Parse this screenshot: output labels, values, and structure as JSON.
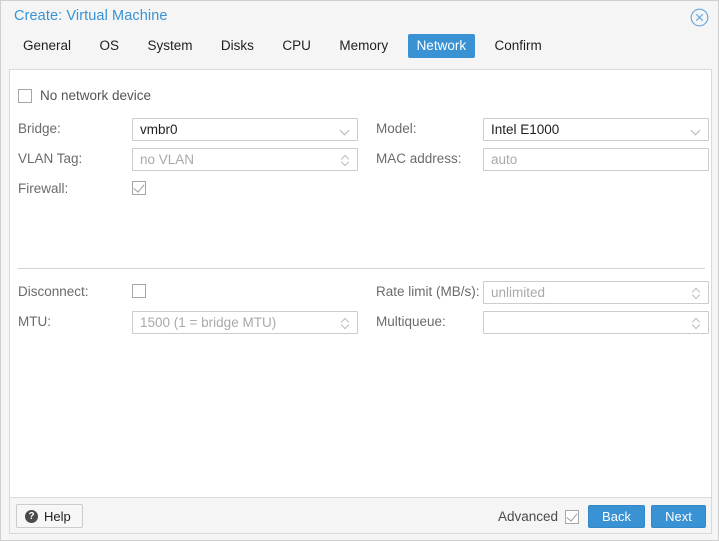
{
  "header": {
    "title": "Create: Virtual Machine",
    "close_icon": "close-circle-icon"
  },
  "tabs": [
    {
      "label": "General",
      "active": false
    },
    {
      "label": "OS",
      "active": false
    },
    {
      "label": "System",
      "active": false
    },
    {
      "label": "Disks",
      "active": false
    },
    {
      "label": "CPU",
      "active": false
    },
    {
      "label": "Memory",
      "active": false
    },
    {
      "label": "Network",
      "active": true
    },
    {
      "label": "Confirm",
      "active": false
    }
  ],
  "form": {
    "no_network_device": {
      "label": "No network device",
      "checked": false
    },
    "bridge": {
      "label": "Bridge:",
      "value": "vmbr0",
      "is_placeholder": false,
      "control": "combobox"
    },
    "vlan_tag": {
      "label": "VLAN Tag:",
      "value": "no VLAN",
      "is_placeholder": true,
      "control": "spinner"
    },
    "firewall": {
      "label": "Firewall:",
      "checked": true
    },
    "model": {
      "label": "Model:",
      "value": "Intel E1000",
      "is_placeholder": false,
      "control": "combobox"
    },
    "mac_address": {
      "label": "MAC address:",
      "value": "auto",
      "is_placeholder": true,
      "control": "text"
    },
    "disconnect": {
      "label": "Disconnect:",
      "checked": false
    },
    "mtu": {
      "label": "MTU:",
      "value": "1500 (1 = bridge MTU)",
      "is_placeholder": true,
      "control": "spinner"
    },
    "rate_limit": {
      "label": "Rate limit (MB/s):",
      "value": "unlimited",
      "is_placeholder": true,
      "control": "spinner"
    },
    "multiqueue": {
      "label": "Multiqueue:",
      "value": "",
      "is_placeholder": true,
      "control": "spinner"
    }
  },
  "footer": {
    "help_label": "Help",
    "help_icon": "question-mark-icon",
    "advanced_label": "Advanced",
    "advanced_checked": true,
    "back_label": "Back",
    "next_label": "Next"
  },
  "colors": {
    "accent_blue": "#3892d4",
    "title_blue": "#3892d4",
    "label_gray": "#6b6b6b",
    "placeholder_gray": "#a9a9a9",
    "panel_bg": "#f5f5f5",
    "content_bg": "#ffffff",
    "border_gray": "#d9d9d9"
  }
}
